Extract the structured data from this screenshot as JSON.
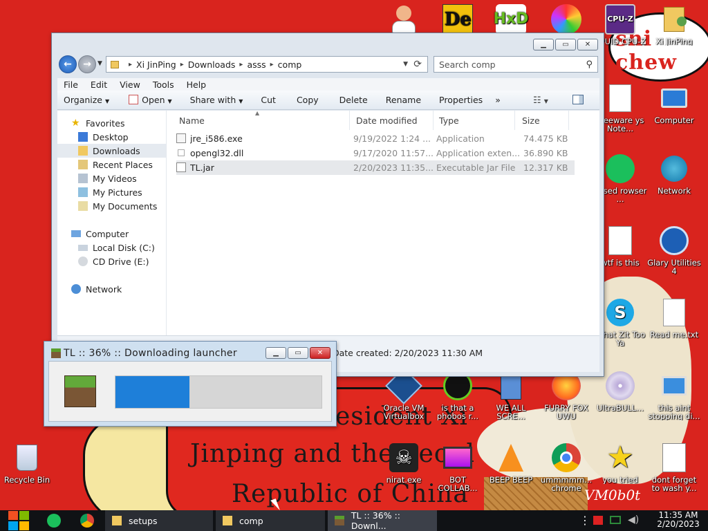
{
  "explorer": {
    "path": [
      "Xi JinPing",
      "Downloads",
      "asss",
      "comp"
    ],
    "search_placeholder": "Search comp",
    "menu": [
      "File",
      "Edit",
      "View",
      "Tools",
      "Help"
    ],
    "toolbar": {
      "organize": "Organize",
      "open": "Open",
      "share": "Share with",
      "cut": "Cut",
      "copy": "Copy",
      "delete": "Delete",
      "rename": "Rename",
      "properties": "Properties",
      "more": "»"
    },
    "nav": {
      "favorites": "Favorites",
      "desktop": "Desktop",
      "downloads": "Downloads",
      "recent": "Recent Places",
      "videos": "My Videos",
      "pictures": "My Pictures",
      "documents": "My Documents",
      "computer": "Computer",
      "local_disk": "Local Disk (C:)",
      "cd_drive": "CD Drive (E:)",
      "network": "Network"
    },
    "columns": {
      "name": "Name",
      "date": "Date modified",
      "type": "Type",
      "size": "Size"
    },
    "files": [
      {
        "name": "jre_i586.exe",
        "date": "9/19/2022 1:24 ...",
        "type": "Application",
        "size": "74.475 KB"
      },
      {
        "name": "opengl32.dll",
        "date": "9/17/2020 11:57...",
        "type": "Application exten...",
        "size": "36.890 KB"
      },
      {
        "name": "TL.jar",
        "date": "2/20/2023 11:35...",
        "type": "Executable Jar File",
        "size": "12.317 KB"
      }
    ],
    "details_text": "Date created: 2/20/2023 11:30 AM"
  },
  "launcher": {
    "title": "TL :: 36% :: Downloading launcher",
    "progress": 0.36
  },
  "desktop_icons": {
    "cpuz": "CPUID CPU-Z",
    "user": "Xi JinPing",
    "freeware": "Freeware ys Note...",
    "computer": "Computer",
    "browser": "based rowser ...",
    "network": "Network",
    "wtf": "wtf is this",
    "glary": "Glary Utilities 4",
    "skype": "What Zit Too Ya",
    "readme": "Read me.txt",
    "vbox": "Oracle VM Virtualbox",
    "phobos": "is that a phobos r...",
    "weall": "WE ALL SCRE...",
    "furry": "FURRY FOX UWU",
    "ultra": "UltraBULL...",
    "thisaint": "this aint stopping di...",
    "recycle": "Recycle Bin",
    "nirat": "nirat.exe",
    "bot": "BOT COLLAB...",
    "beep": "BEEP BEEP",
    "ummm": "ummmmm... chrome",
    "youtried": "you tried",
    "dontforget": "dont forget to wash y..."
  },
  "wallpaper": {
    "line1": "esident Xi",
    "line2": "Jinping and the Peopl",
    "line3": "Republic of China",
    "corner": "shi chew",
    "signature": "VM0b0t"
  },
  "taskbar": {
    "setups": "setups",
    "comp": "comp",
    "launcher": "TL :: 36% :: Downl...",
    "time": "11:35 AM",
    "date": "2/20/2023"
  },
  "colors": {
    "wallpaper_red": "#d9241e",
    "progress_blue": "#1e7fd9",
    "taskbar": "#101215"
  }
}
